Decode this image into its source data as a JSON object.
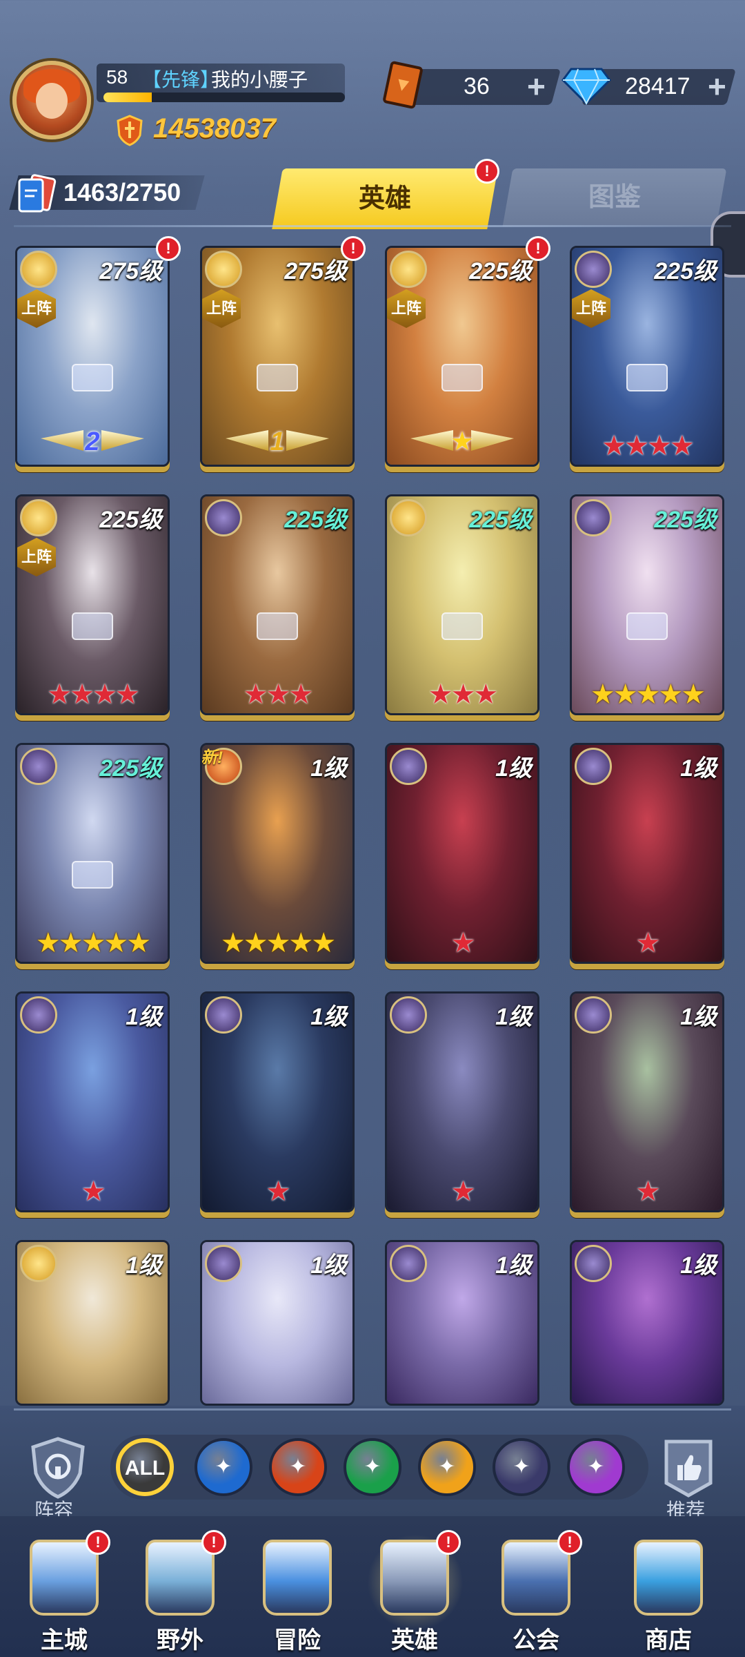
{
  "player": {
    "level": "58",
    "rank": "【先锋】",
    "name": "我的小腰子",
    "xp_fraction": 0.2,
    "power": "14538037"
  },
  "resources": {
    "tickets": "36",
    "diamonds": "28417"
  },
  "collection": {
    "count": "1463/2750"
  },
  "tabs": {
    "heroes": "英雄",
    "codex": "图鉴",
    "heroes_badge": "!"
  },
  "deployed_label": "上阵",
  "new_label": "新!",
  "badge_text": "!",
  "heroes": [
    {
      "level": "275级",
      "deployed": true,
      "badge": true,
      "rank": "2",
      "stars": 0,
      "star_color": "",
      "faction": "light",
      "art": [
        "#dfe6f0",
        "#8aa2c8",
        "#4b6a9a"
      ]
    },
    {
      "level": "275级",
      "deployed": true,
      "badge": true,
      "rank": "1",
      "stars": 0,
      "star_color": "",
      "faction": "light",
      "art": [
        "#e8c070",
        "#b07a30",
        "#6a4a20"
      ]
    },
    {
      "level": "225级",
      "deployed": true,
      "badge": true,
      "rank": "★",
      "stars": 0,
      "star_color": "",
      "faction": "light",
      "art": [
        "#f0c890",
        "#d28040",
        "#8a4a20"
      ]
    },
    {
      "level": "225级",
      "deployed": true,
      "badge": false,
      "rank": "",
      "stars": 4,
      "star_color": "red",
      "faction": "dark",
      "art": [
        "#9ab4e0",
        "#3a5a9a",
        "#223460"
      ]
    },
    {
      "level": "225级",
      "deployed": true,
      "badge": false,
      "rank": "",
      "stars": 4,
      "star_color": "red",
      "faction": "light",
      "art": [
        "#e8e2e8",
        "#6a5a66",
        "#2a2228"
      ]
    },
    {
      "level": "225级",
      "teal": true,
      "deployed": false,
      "badge": false,
      "rank": "",
      "stars": 3,
      "star_color": "red",
      "faction": "dark",
      "art": [
        "#e8c8a0",
        "#9a6a40",
        "#5a3a20"
      ]
    },
    {
      "level": "225级",
      "teal": true,
      "deployed": false,
      "badge": false,
      "rank": "",
      "stars": 3,
      "star_color": "red",
      "faction": "light",
      "art": [
        "#f4eeb0",
        "#d4c070",
        "#8a7a40"
      ]
    },
    {
      "level": "225级",
      "teal": true,
      "deployed": false,
      "badge": false,
      "rank": "",
      "stars": 5,
      "star_color": "gold",
      "faction": "dark",
      "art": [
        "#f0e0f0",
        "#b49ac0",
        "#6a4a5a"
      ]
    },
    {
      "level": "225级",
      "teal": true,
      "deployed": false,
      "badge": false,
      "rank": "",
      "stars": 5,
      "star_color": "gold",
      "faction": "dark",
      "art": [
        "#d0d8f0",
        "#7a86b0",
        "#3a3a5a"
      ]
    },
    {
      "level": "1级",
      "new": true,
      "deployed": false,
      "badge": false,
      "rank": "",
      "stars": 5,
      "star_color": "gold",
      "faction": "fire",
      "art": [
        "#e8a050",
        "#6a4a3a",
        "#2a2a3a"
      ]
    },
    {
      "level": "1级",
      "deployed": false,
      "badge": false,
      "rank": "",
      "stars": 1,
      "star_color": "red",
      "faction": "dark",
      "art": [
        "#c84050",
        "#702030",
        "#301018"
      ]
    },
    {
      "level": "1级",
      "deployed": false,
      "badge": false,
      "rank": "",
      "stars": 1,
      "star_color": "red",
      "faction": "dark",
      "art": [
        "#c84050",
        "#702030",
        "#301018"
      ]
    },
    {
      "level": "1级",
      "deployed": false,
      "badge": false,
      "rank": "",
      "stars": 1,
      "star_color": "red",
      "faction": "dark",
      "art": [
        "#7aa0e0",
        "#4a5aa0",
        "#283060"
      ]
    },
    {
      "level": "1级",
      "deployed": false,
      "badge": false,
      "rank": "",
      "stars": 1,
      "star_color": "red",
      "faction": "dark",
      "art": [
        "#5a7aa8",
        "#2a3a60",
        "#121a30"
      ]
    },
    {
      "level": "1级",
      "deployed": false,
      "badge": false,
      "rank": "",
      "stars": 1,
      "star_color": "red",
      "faction": "dark",
      "art": [
        "#8a8ac0",
        "#4a4a70",
        "#1a1a30"
      ]
    },
    {
      "level": "1级",
      "deployed": false,
      "badge": false,
      "rank": "",
      "stars": 1,
      "star_color": "red",
      "faction": "dark",
      "art": [
        "#a8c0a0",
        "#5a4a5a",
        "#2a1a2a"
      ]
    },
    {
      "level": "1级",
      "deployed": false,
      "badge": false,
      "rank": "",
      "stars": 0,
      "star_color": "red",
      "faction": "light",
      "art": [
        "#f0e8d8",
        "#d4b880",
        "#8a7040"
      ]
    },
    {
      "level": "1级",
      "deployed": false,
      "badge": false,
      "rank": "",
      "stars": 0,
      "star_color": "red",
      "faction": "dark",
      "art": [
        "#e8e8f8",
        "#b8b8e0",
        "#6a6a9a"
      ]
    },
    {
      "level": "1级",
      "deployed": false,
      "badge": false,
      "rank": "",
      "stars": 0,
      "star_color": "red",
      "faction": "dark",
      "art": [
        "#c0a8e8",
        "#7a6aa8",
        "#3a2a60"
      ]
    },
    {
      "level": "1级",
      "deployed": false,
      "badge": false,
      "rank": "",
      "stars": 0,
      "star_color": "red",
      "faction": "dark",
      "art": [
        "#b070d0",
        "#6a3a9a",
        "#2a1a50"
      ]
    }
  ],
  "filters": {
    "lineup_label": "阵容",
    "recommend_label": "推荐",
    "all_label": "ALL",
    "items": [
      {
        "name": "all",
        "color": "#3a3a3a",
        "ring": "#ffd23a"
      },
      {
        "name": "water",
        "color": "#1e6ad0",
        "ring": "#1e2840"
      },
      {
        "name": "fire",
        "color": "#d84418",
        "ring": "#1e2840"
      },
      {
        "name": "wind",
        "color": "#1aa04a",
        "ring": "#1e2840"
      },
      {
        "name": "light",
        "color": "#f0a21a",
        "ring": "#1e2840"
      },
      {
        "name": "dark",
        "color": "#3a3a6a",
        "ring": "#1e2840"
      },
      {
        "name": "arcane",
        "color": "#a03ad0",
        "ring": "#1e2840"
      }
    ]
  },
  "nav": [
    {
      "label": "主城",
      "badge": true,
      "color": "#6aa0e0"
    },
    {
      "label": "野外",
      "badge": true,
      "color": "#7ab0d8"
    },
    {
      "label": "冒险",
      "badge": false,
      "color": "#4a90e0"
    },
    {
      "label": "英雄",
      "badge": true,
      "color": "#8a9ab8",
      "active": true
    },
    {
      "label": "公会",
      "badge": true,
      "color": "#4a70b0"
    },
    {
      "label": "商店",
      "badge": false,
      "color": "#3aa0e0"
    }
  ]
}
